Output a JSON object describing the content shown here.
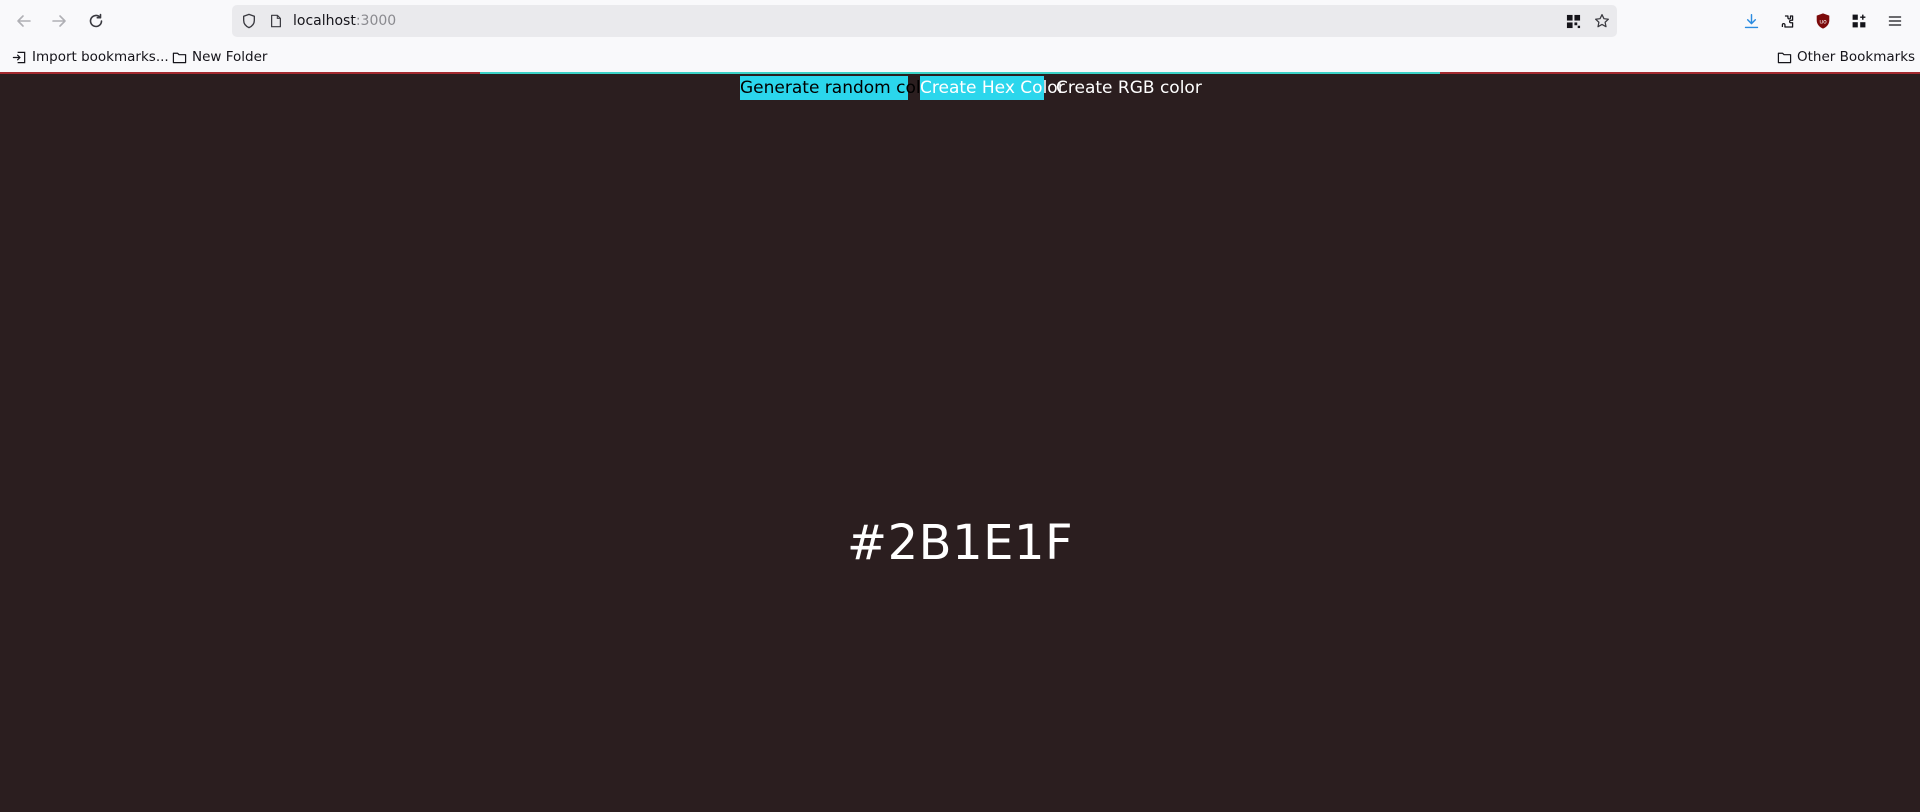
{
  "browser": {
    "url_host": "localhost",
    "url_port": ":3000",
    "bookmarks": {
      "import_label": "Import bookmarks...",
      "new_folder_label": "New Folder",
      "other_label": "Other Bookmarks"
    },
    "accent_color": "#a32a2f"
  },
  "page": {
    "background_color": "#2B1E1F",
    "nav": {
      "random_label": "Generate random color",
      "hex_label": "Create Hex Color",
      "rgb_label": "Create RGB color"
    },
    "color_code": "#2B1E1F",
    "button_color": "#2bd6ec"
  }
}
